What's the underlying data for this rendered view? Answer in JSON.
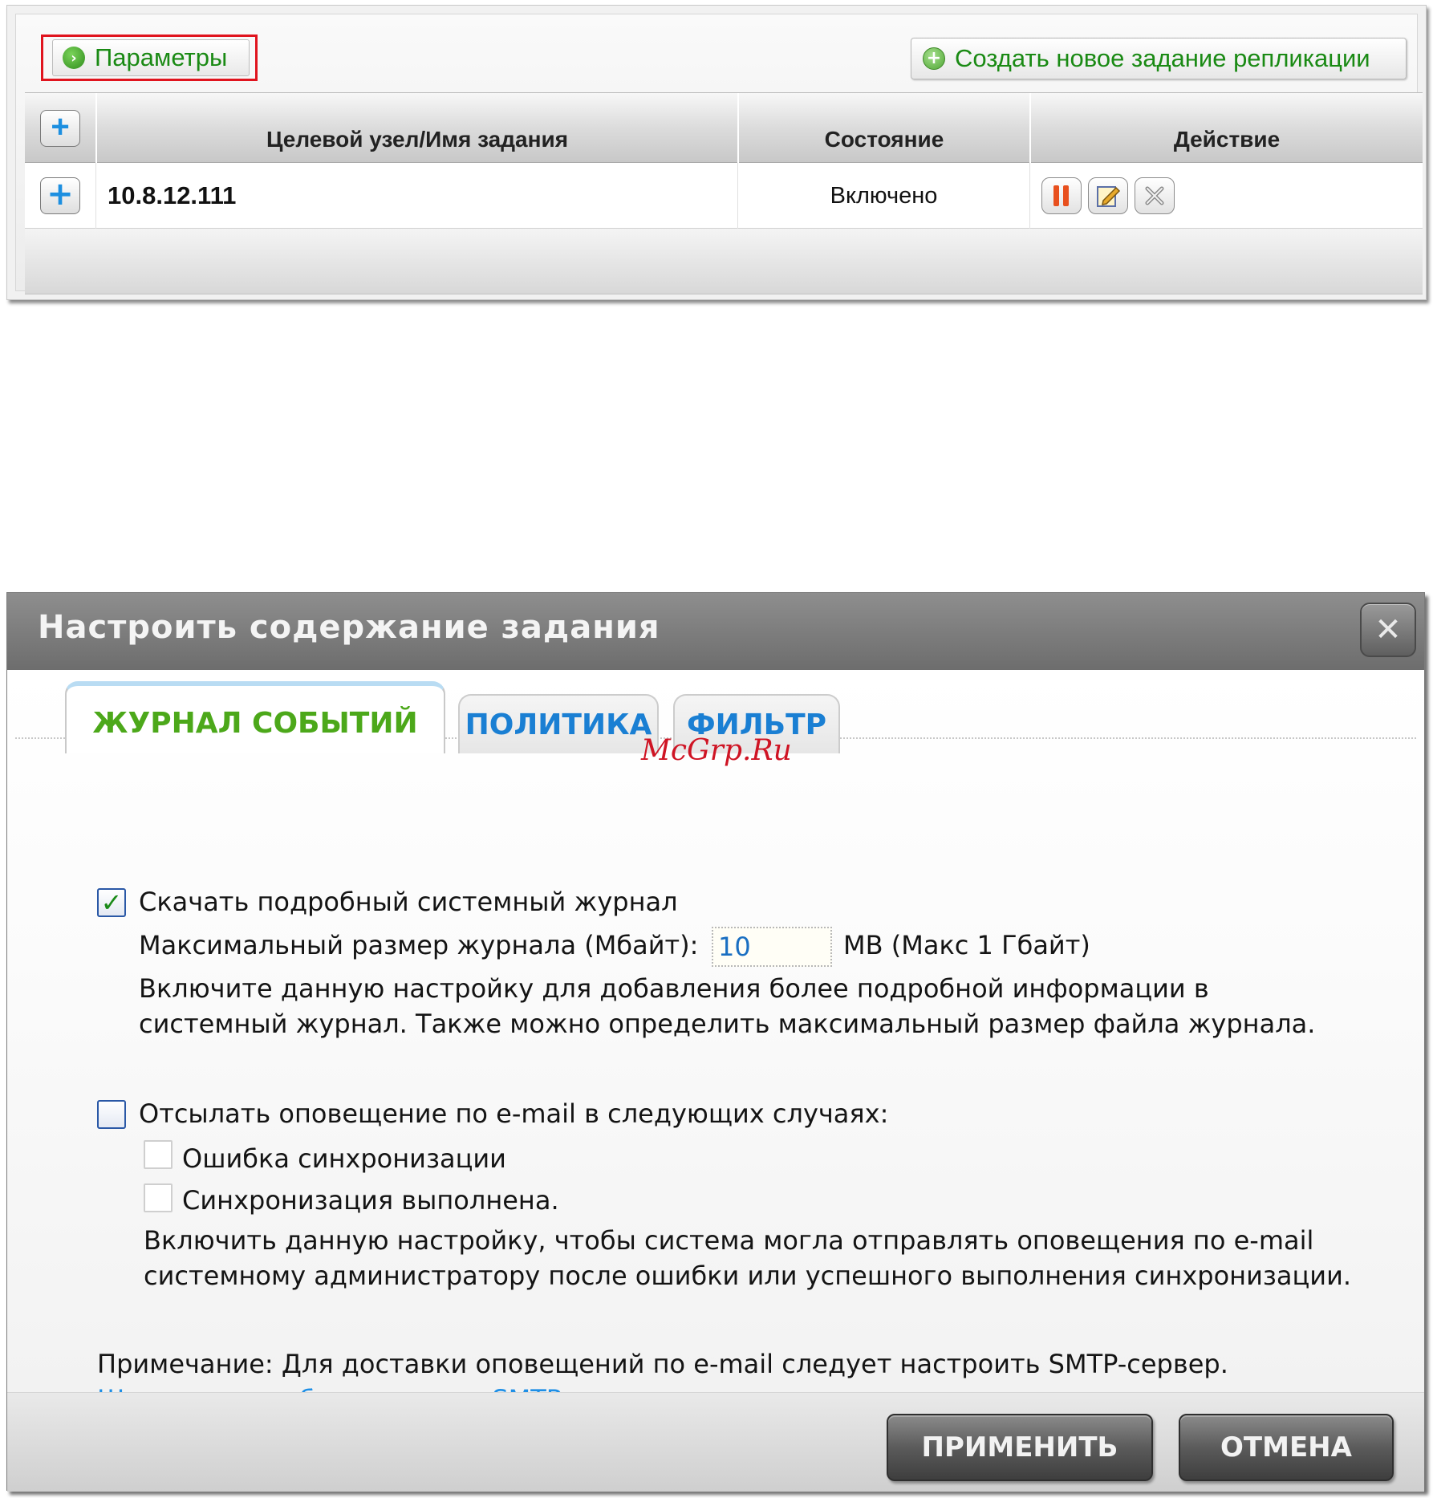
{
  "toolbar": {
    "params_label": "Параметры",
    "create_label": "Создать новое задание репликации"
  },
  "table": {
    "columns": [
      "Целевой узел/Имя задания",
      "Состояние",
      "Действие"
    ],
    "rows": [
      {
        "target": "10.8.12.111",
        "status": "Включено",
        "actions": [
          "pause-icon",
          "edit-icon",
          "delete-icon"
        ]
      }
    ]
  },
  "dialog": {
    "title": "Настроить содержание задания",
    "tabs": [
      "ЖУРНАЛ СОБЫТИЙ",
      "ПОЛИТИКА",
      "ФИЛЬТР"
    ],
    "active_tab": "ЖУРНАЛ СОБЫТИЙ",
    "watermark": "McGrp.Ru",
    "log": {
      "checkbox_label": "Скачать подробный системный журнал",
      "checked": true,
      "size_label": "Максимальный размер журнала (Мбайт):",
      "size_value": "10",
      "size_unit": "MB (Макс 1 Гбайт)",
      "desc_line1": "Включите данную настройку для добавления более подробной информации в",
      "desc_line2": "системный журнал. Также можно определить максимальный размер файла журнала."
    },
    "email": {
      "checkbox_label": "Отсылать оповещение по e-mail в следующих случаях:",
      "checked": false,
      "option1": "Ошибка синхронизации",
      "option2": "Синхронизация выполнена.",
      "desc_line1": "Включить данную настройку, чтобы система могла отправлять оповещения по e-mail",
      "desc_line2": "системному администратору после ошибки или успешного выполнения синхронизации."
    },
    "note": "Примечание: Для доставки оповещений по e-mail следует настроить SMTP-сервер.",
    "smtp_link": "Щелкните, чтобы настроить SMTP-сервер",
    "apply_label": "ПРИМЕНИТЬ",
    "cancel_label": "ОТМЕНА"
  },
  "colors": {
    "accent_green": "#1a8a14",
    "link_blue": "#1e8fe6",
    "highlight_red": "#e0141e"
  }
}
